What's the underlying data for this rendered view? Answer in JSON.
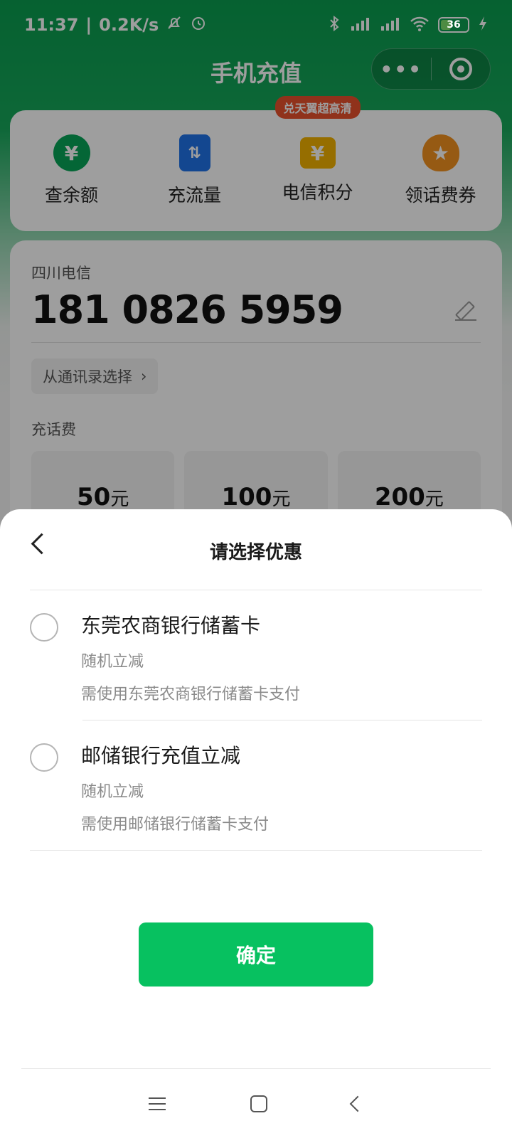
{
  "status_bar": {
    "time": "11:37",
    "separator": "|",
    "net_speed": "0.2K/s",
    "battery": "36",
    "icons": [
      "mute-bell-icon",
      "alarm-icon",
      "bluetooth-icon",
      "hd-signal-icon",
      "hd-signal-icon",
      "wifi-icon",
      "battery-icon",
      "charging-icon"
    ]
  },
  "header": {
    "title": "手机充值",
    "more_glyph": "•••"
  },
  "quick_actions": {
    "items": [
      {
        "label": "查余额",
        "icon": "yuan-search-icon",
        "glyph": "¥"
      },
      {
        "label": "充流量",
        "icon": "data-flow-icon",
        "glyph": "⇅"
      },
      {
        "label": "电信积分",
        "icon": "points-ticket-icon",
        "glyph": "¥",
        "tag": "兑天翼超高清"
      },
      {
        "label": "领话费券",
        "icon": "coupon-bag-icon",
        "glyph": "★"
      }
    ]
  },
  "phone": {
    "carrier": "四川电信",
    "number": "181 0826 5959",
    "contacts_label": "从通讯录选择",
    "chevron": "›",
    "section_label": "充话费",
    "amounts": [
      {
        "value": "50",
        "unit": "元"
      },
      {
        "value": "100",
        "unit": "元"
      },
      {
        "value": "200",
        "unit": "元"
      }
    ]
  },
  "sheet": {
    "title": "请选择优惠",
    "options": [
      {
        "title": "东莞农商银行储蓄卡",
        "sub": "随机立减",
        "desc": "需使用东莞农商银行储蓄卡支付"
      },
      {
        "title": "邮储银行充值立减",
        "sub": "随机立减",
        "desc": "需使用邮储银行储蓄卡支付"
      }
    ],
    "confirm_label": "确定"
  },
  "colors": {
    "brand_green": "#07c160",
    "header_green": "#0a9d4f"
  }
}
